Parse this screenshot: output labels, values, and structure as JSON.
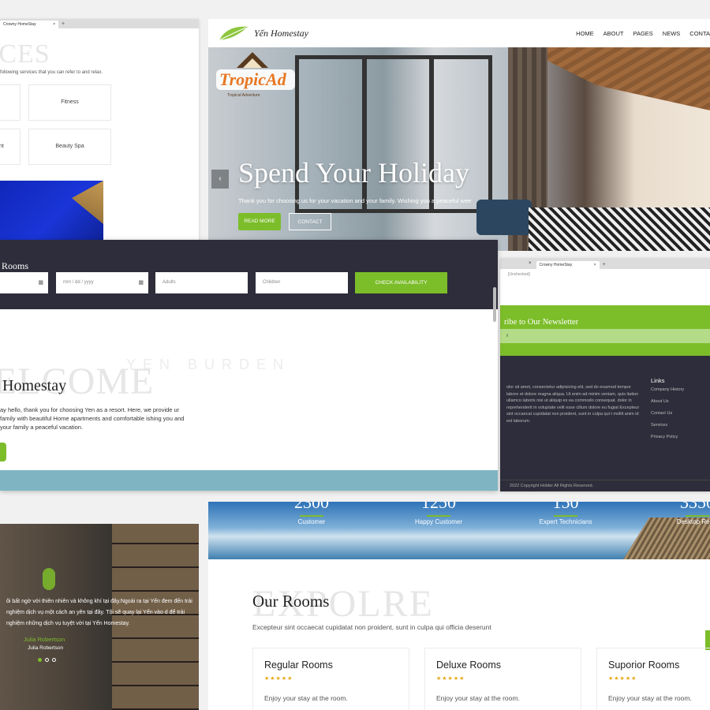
{
  "services": {
    "tab_title": "Crowny HomeStay",
    "ghost": "ICES",
    "lead": "following services that you can refer to and relax.",
    "items": [
      "Fitness",
      "nt",
      "Beauty Spa"
    ]
  },
  "hero": {
    "brand": "Yến Homestay",
    "menu": [
      "HOME",
      "ABOUT",
      "PAGES",
      "NEWS",
      "CONTA"
    ],
    "logo_text": "TropicAd",
    "logo_small": "Tropical Adventure",
    "title": "Spend Your Holiday",
    "subtitle": "Thank you for choosing us for your vacation and your family. Wishing you a peaceful wee",
    "read_more": "READ MORE",
    "contact": "CONTACT",
    "prev_icon": "‹"
  },
  "booking": {
    "title": "r Rooms",
    "date_placeholder": "mm / dd / yyyy",
    "adults": "Adults",
    "children": "Children",
    "check": "CHECK AVAILABILITY"
  },
  "welcome": {
    "ghost": "ELCOME",
    "ghost2": "YEN BURDEN",
    "title": "Homestay",
    "text": "ay hello, thank you for choosing Yen as a resort. Here, we provide ur family with beautiful Home apartments and comfortable ishing you and your family a peaceful vacation."
  },
  "newsletter": {
    "tab_title": "Crowny HomeStay",
    "unchecked": "[Unchecked]",
    "title": "ribe to Our Newsletter",
    "input": "il",
    "footer_text": "olor sit amet, consectetur adipisicing elit, sed do eiusmod tempor labore et dolore magna aliqua. Ut enim ad minim veniam, quis itation ullamco laboris nisi ut aliquip ex ea commodo consequat. dolor in reprehenderit in voluptate velit esse cillum dolore eu fugiat Excepteur sint occaecat cupidatat non proident, sunt in culpa qui t mollit anim id est laborum.",
    "links_title": "Links",
    "links": [
      "Company History",
      "About Us",
      "Contact Us",
      "Services",
      "Privacy Policy"
    ],
    "copyright": "2022 Copyright Holder All Rights Reserved."
  },
  "testimonial": {
    "text": "ôi bất ngờ với thiên nhiên và không khí tại đây.Ngoài ra tại Yến đem đến trải nghiệm dịch vụ một cách an yên tại đây. Tôi sẽ quay lại Yến vào d để trải nghiệm những dịch vụ tuyệt vời tại Yến Homestay.",
    "name": "Julia Robertson",
    "name2": "Julia Robertson"
  },
  "stats": [
    {
      "num": "2300",
      "label": "Customer"
    },
    {
      "num": "1250",
      "label": "Happy Customer"
    },
    {
      "num": "150",
      "label": "Expert Technicians"
    },
    {
      "num": "3350",
      "label": "Desktop Repai"
    }
  ],
  "rooms": {
    "ghost": "EXPOLRE",
    "title": "Our Rooms",
    "subtitle": "Excepteur sint occaecat cupidatat non proident, sunt in culpa qui officia deserunt",
    "cards": [
      {
        "name": "Regular Rooms",
        "stars": "★★★★★",
        "desc": "Enjoy your stay at the room."
      },
      {
        "name": "Deluxe Rooms",
        "stars": "★★★★★",
        "desc": "Enjoy your stay at the room."
      },
      {
        "name": "Suporior Rooms",
        "stars": "★★★★★",
        "desc": "Enjoy your stay at the room."
      }
    ]
  },
  "colors": {
    "accent": "#7cbd2a",
    "dark": "#2e2d3b",
    "footer_band": "#7fb5c3"
  }
}
